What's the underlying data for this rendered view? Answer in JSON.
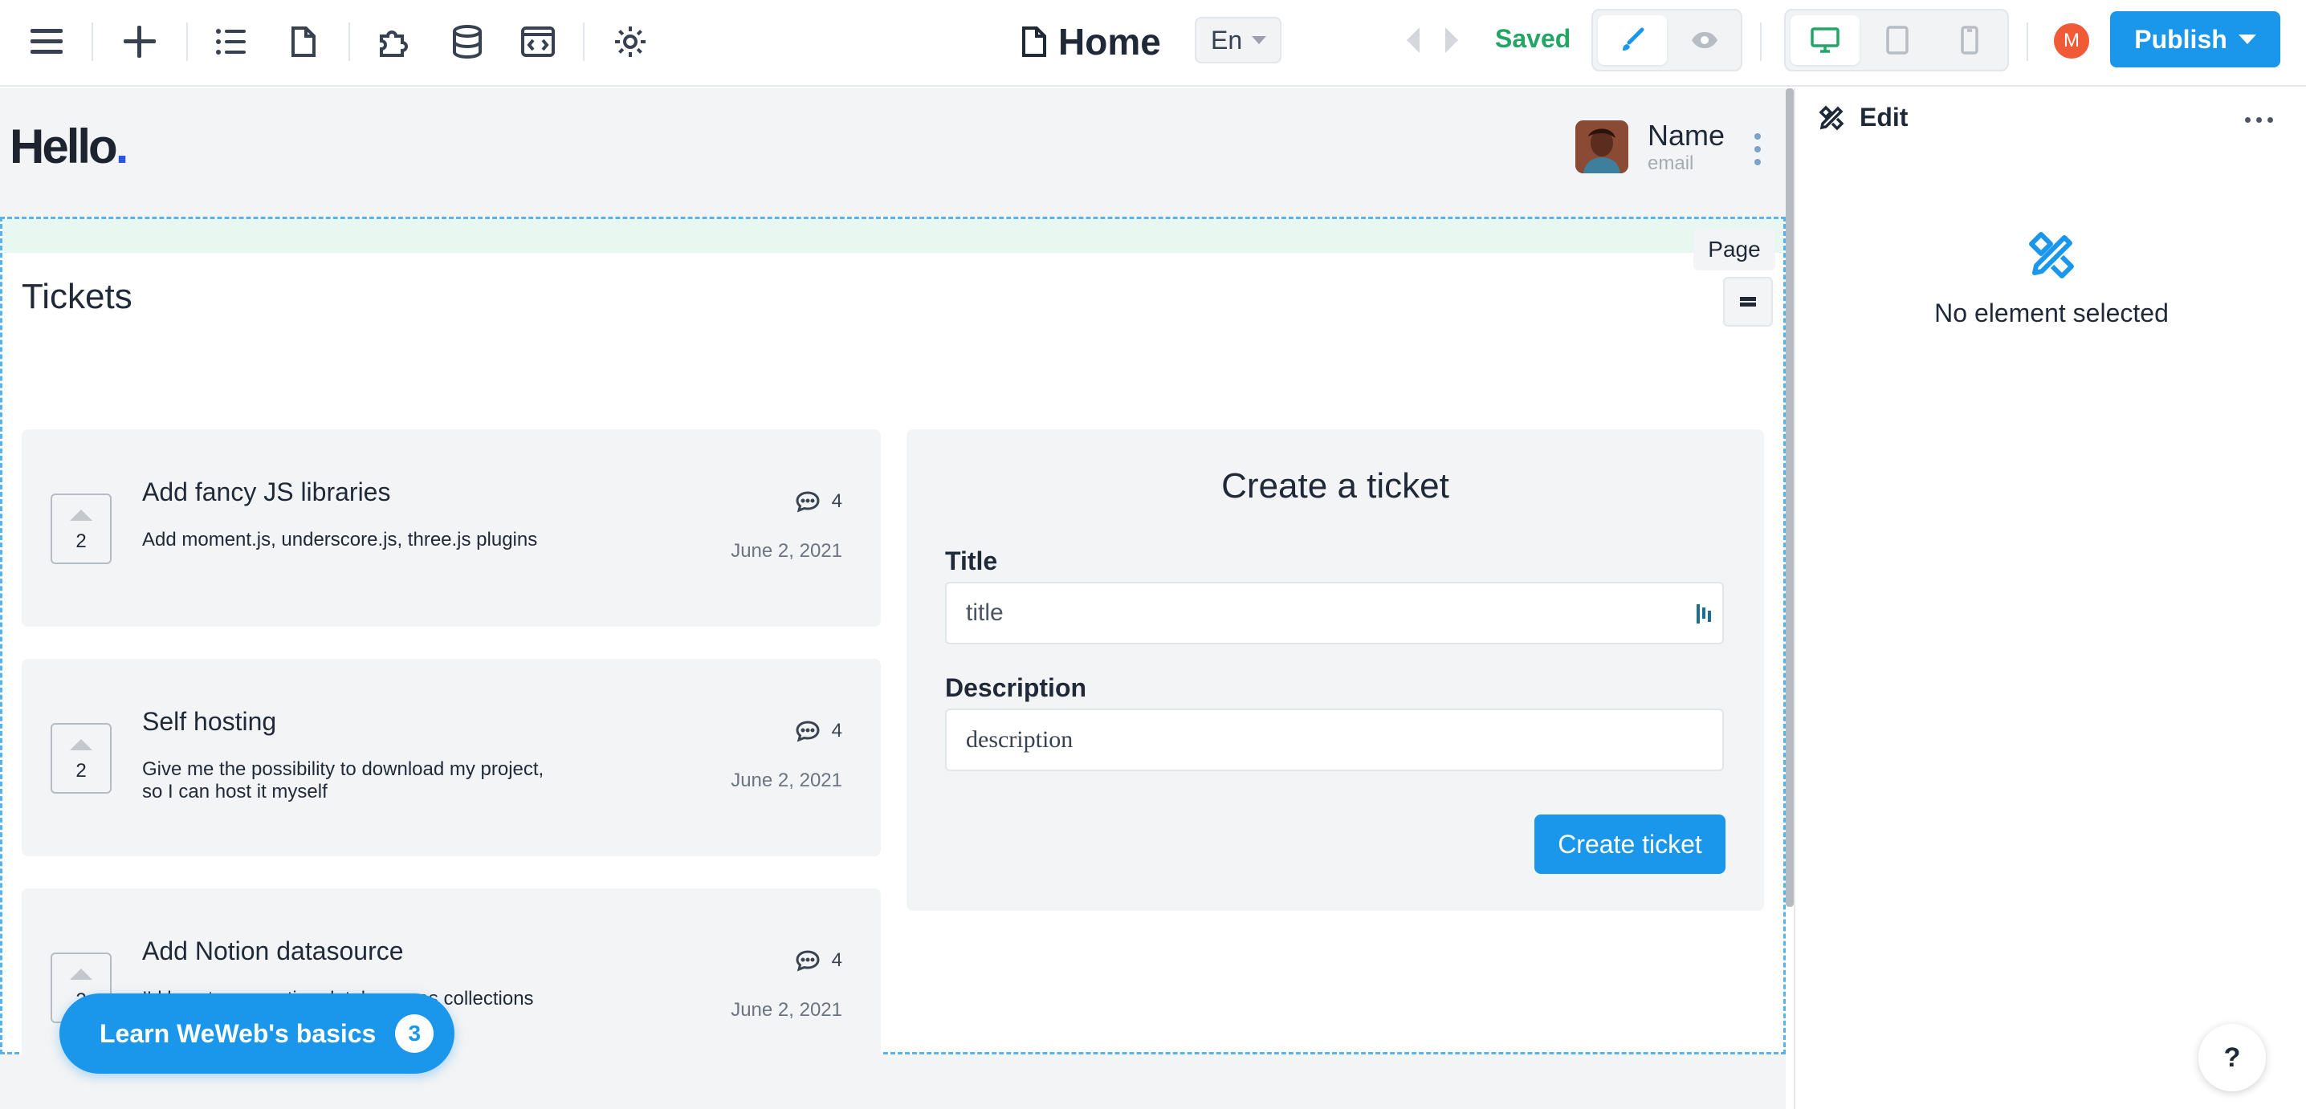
{
  "toolbar": {
    "page_title": "Home",
    "language": "En",
    "status": "Saved",
    "avatar_initial": "M",
    "publish_label": "Publish",
    "icons": [
      "menu-icon",
      "plus-icon",
      "list-icon",
      "page-icon",
      "puzzle-icon",
      "database-icon",
      "code-icon",
      "gear-icon"
    ],
    "mode_icons": [
      "brush-icon",
      "eye-icon"
    ],
    "device_icons": [
      "desktop-icon",
      "tablet-icon",
      "mobile-icon"
    ]
  },
  "colors": {
    "accent": "#1a96eb",
    "status_green": "#22a565",
    "avatar": "#f05a37",
    "section_border": "#58b3ec"
  },
  "canvas": {
    "logo_text": "Hello",
    "logo_dot": ".",
    "user_name": "Name",
    "user_email": "email",
    "section_tag": "Page",
    "tickets_heading": "Tickets",
    "tickets": [
      {
        "votes": "2",
        "title": "Add fancy JS libraries",
        "description": "Add moment.js, underscore.js, three.js plugins",
        "comments": "4",
        "date": "June 2, 2021"
      },
      {
        "votes": "2",
        "title": "Self hosting",
        "description": "Give me the possibility to download my project, so I can host it myself",
        "comments": "4",
        "date": "June 2, 2021"
      },
      {
        "votes": "2",
        "title": "Add Notion datasource",
        "description": "I'd love to use notion databases as collections",
        "comments": "4",
        "date": "June 2, 2021"
      }
    ],
    "form": {
      "heading": "Create a ticket",
      "title_label": "Title",
      "title_placeholder": "title",
      "description_label": "Description",
      "description_placeholder": "description",
      "submit_label": "Create ticket"
    },
    "learn_label": "Learn WeWeb's basics",
    "learn_count": "3"
  },
  "panel": {
    "heading": "Edit",
    "empty_text": "No element selected",
    "help_label": "?"
  }
}
